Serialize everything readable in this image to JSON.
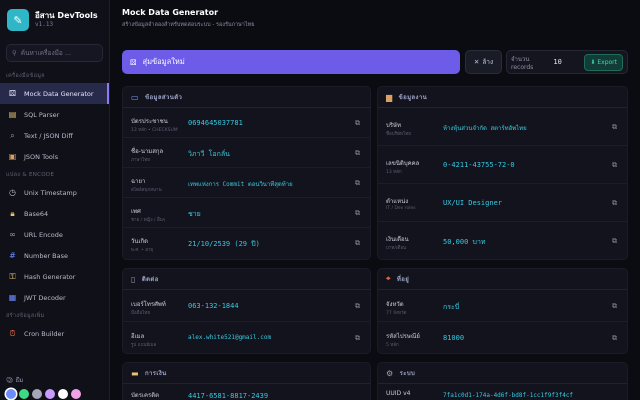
{
  "app": {
    "name": "อีสาน DevTools",
    "version": "v1.13"
  },
  "sidebar": {
    "search_placeholder": "ค้นหาเครื่องมือ ...",
    "section_data": "เครื่องมือข้อมูล",
    "section_encode": "แปลง & ENCODE",
    "section_gen": "สร้างข้อมูลเพิ่ม",
    "items_data": [
      {
        "label": "Mock Data Generator",
        "icon": "dice-icon"
      },
      {
        "label": "SQL Parser",
        "icon": "scroll-icon"
      },
      {
        "label": "Text / JSON Diff",
        "icon": "magnifier-icon"
      },
      {
        "label": "JSON Tools",
        "icon": "package-icon"
      }
    ],
    "items_encode": [
      {
        "label": "Unix Timestamp",
        "icon": "clock-icon"
      },
      {
        "label": "Base64",
        "icon": "lock-icon"
      },
      {
        "label": "URL Encode",
        "icon": "link-icon"
      },
      {
        "label": "Number Base",
        "icon": "numbers-icon"
      },
      {
        "label": "Hash Generator",
        "icon": "key-icon"
      },
      {
        "label": "JWT Decoder",
        "icon": "token-icon"
      }
    ],
    "items_gen": [
      {
        "label": "Cron Builder",
        "icon": "alarm-icon"
      }
    ],
    "theme_label": "ธีม",
    "theme_colors": [
      "#6c8cff",
      "#3ddc84",
      "#a3a7b8",
      "#c79bff",
      "#ffffff",
      "#f3a1e6"
    ]
  },
  "header": {
    "title": "Mock Data Generator",
    "subtitle": "สร้างข้อมูลจำลองสำหรับทดสอบระบบ - รองรับภาษาไทย"
  },
  "toolbar": {
    "generate_label": "สุ่มข้อมูลใหม่",
    "clear_label": "ล้าง",
    "records_label": "จำนวน records",
    "records_value": "10",
    "export_label": "Export"
  },
  "cards": {
    "personal": {
      "title": "ข้อมูลส่วนตัว",
      "rows": [
        {
          "label": "บัตรประชาชน",
          "sub": "13 หลัก • CHECKSUM",
          "value": "0694645037781"
        },
        {
          "label": "ชื่อ-นามสกุล",
          "sub": "ภาษาไทย",
          "value": "วิภาวี โอกลั่น"
        },
        {
          "label": "ฉายา",
          "sub": "สไตล์สนุกสนาน",
          "value": "เทพแห่งการ Commit ตอนวินาทีสุดท้าย"
        },
        {
          "label": "เพศ",
          "sub": "ชาย / หญิง / อื่นๆ",
          "value": "ชาย"
        },
        {
          "label": "วันเกิด",
          "sub": "พ.ศ. • อายุ",
          "value": "21/10/2539 (29 ปี)"
        }
      ]
    },
    "work": {
      "title": "ข้อมูลงาน",
      "rows": [
        {
          "label": "บริษัท",
          "sub": "ชื่อบริษัทไทย",
          "value": "ห้างหุ้นส่วนจำกัด สตาร์ทอัพไทย"
        },
        {
          "label": "เลขนิติบุคคล",
          "sub": "13 หลัก",
          "value": "0-4211-43755-72-0"
        },
        {
          "label": "ตำแหน่ง",
          "sub": "IT / Dev roles",
          "value": "UX/UI Designer"
        },
        {
          "label": "เงินเดือน",
          "sub": "บาท/เดือน",
          "value": "50,000 บาท"
        }
      ]
    },
    "contact": {
      "title": "ติดต่อ",
      "rows": [
        {
          "label": "เบอร์โทรศัพท์",
          "sub": "มือถือไทย",
          "value": "063-132-1844"
        },
        {
          "label": "อีเมล",
          "sub": "รูป แบบอีเมล",
          "value": "alex.white521@gmail.com"
        }
      ]
    },
    "address": {
      "title": "ที่อยู่",
      "rows": [
        {
          "label": "จังหวัด",
          "sub": "77 จังหวัด",
          "value": "กระบี่"
        },
        {
          "label": "รหัสไปรษณีย์",
          "sub": "5 หลัก",
          "value": "81000"
        }
      ]
    },
    "finance": {
      "title": "การเงิน",
      "rows": [
        {
          "label": "บัตรเครดิต",
          "sub": "",
          "value": "4417-6581-8817-2439"
        }
      ]
    },
    "system": {
      "title": "ระบบ",
      "rows": [
        {
          "label": "UUID v4",
          "sub": "",
          "value": "7fa1c0d1-174a-4d6f-bd8f-1cc1f9f3f4cf"
        }
      ]
    }
  }
}
